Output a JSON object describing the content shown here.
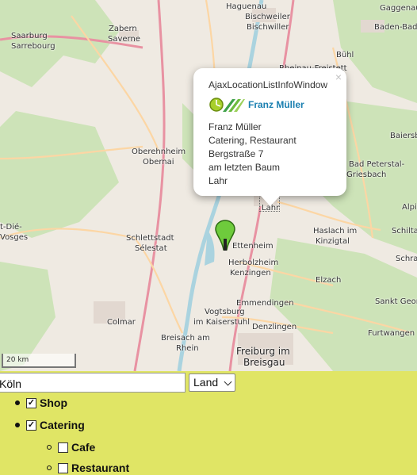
{
  "map": {
    "places": [
      {
        "id": "haguenau",
        "name": "Haguenau"
      },
      {
        "id": "bischweiler",
        "name": "Bischweiler"
      },
      {
        "id": "bischwiller",
        "name": "Bischwiller"
      },
      {
        "id": "gaggenau",
        "name": "Gaggenau"
      },
      {
        "id": "baden-baden",
        "name": "Baden-Baden"
      },
      {
        "id": "zabern",
        "name": "Zabern"
      },
      {
        "id": "saverne",
        "name": "Saverne"
      },
      {
        "id": "saarburg",
        "name": "Saarburg"
      },
      {
        "id": "sarrebourg",
        "name": "Sarrebourg"
      },
      {
        "id": "rheinau",
        "name": "Rheinau-Freistett"
      },
      {
        "id": "buhl",
        "name": "Bühl"
      },
      {
        "id": "oberehnheim",
        "name": "Oberehnheim"
      },
      {
        "id": "obernai",
        "name": "Obernai"
      },
      {
        "id": "baiersbronn",
        "name": "Baiersbronn"
      },
      {
        "id": "peterstal",
        "name": "Bad Peterstal-"
      },
      {
        "id": "griesbach",
        "name": "Griesbach"
      },
      {
        "id": "lahr",
        "name": "Lahr"
      },
      {
        "id": "st-die",
        "name": "t-Dié-"
      },
      {
        "id": "vosges",
        "name": "Vosges"
      },
      {
        "id": "alpir",
        "name": "Alpir"
      },
      {
        "id": "haslach",
        "name": "Haslach im"
      },
      {
        "id": "kinzigtal",
        "name": "Kinzigtal"
      },
      {
        "id": "schiltach",
        "name": "Schiltac"
      },
      {
        "id": "schlettstadt",
        "name": "Schlettstadt"
      },
      {
        "id": "selestat",
        "name": "Sélestat"
      },
      {
        "id": "ettenheim",
        "name": "Ettenheim"
      },
      {
        "id": "herbolzheim",
        "name": "Herbolzheim"
      },
      {
        "id": "kenzingen",
        "name": "Kenzingen"
      },
      {
        "id": "schramberg",
        "name": "Schra"
      },
      {
        "id": "elzach",
        "name": "Elzach"
      },
      {
        "id": "emmendingen",
        "name": "Emmendingen"
      },
      {
        "id": "sanktgeorg",
        "name": "Sankt Georg"
      },
      {
        "id": "vogtsburg",
        "name": "Vogtsburg"
      },
      {
        "id": "kaiserstuhl",
        "name": "im Kaiserstuhl"
      },
      {
        "id": "colmar",
        "name": "Colmar"
      },
      {
        "id": "denzlingen",
        "name": "Denzlingen"
      },
      {
        "id": "furtwangen",
        "name": "Furtwangen"
      },
      {
        "id": "breisach",
        "name": "Breisach am"
      },
      {
        "id": "rhein",
        "name": "Rhein"
      },
      {
        "id": "freiburg",
        "name": "Freiburg im"
      },
      {
        "id": "breisgau",
        "name": "Breisgau"
      }
    ],
    "scale_label": "20 km"
  },
  "popup": {
    "title": "AjaxLocationListInfoWindow",
    "close_label": "×",
    "brand_name": "Franz Müller",
    "lines": [
      "Franz Müller",
      "Catering, Restaurant",
      "Bergstraße 7",
      "am letzten Baum",
      "Lahr"
    ]
  },
  "controls": {
    "search_value": "Köln",
    "select_value": "Land"
  },
  "tree": [
    {
      "label": "Shop",
      "checked": true
    },
    {
      "label": "Catering",
      "checked": true
    },
    {
      "label": "Cafe",
      "checked": false
    },
    {
      "label": "Restaurant",
      "checked": false
    }
  ],
  "check_glyph": "✓",
  "colors": {
    "panel": "#e0e565",
    "link": "#1a7fb0",
    "water": "#aad3df",
    "motorway": "#e892a2",
    "primary": "#fcd6a4"
  }
}
